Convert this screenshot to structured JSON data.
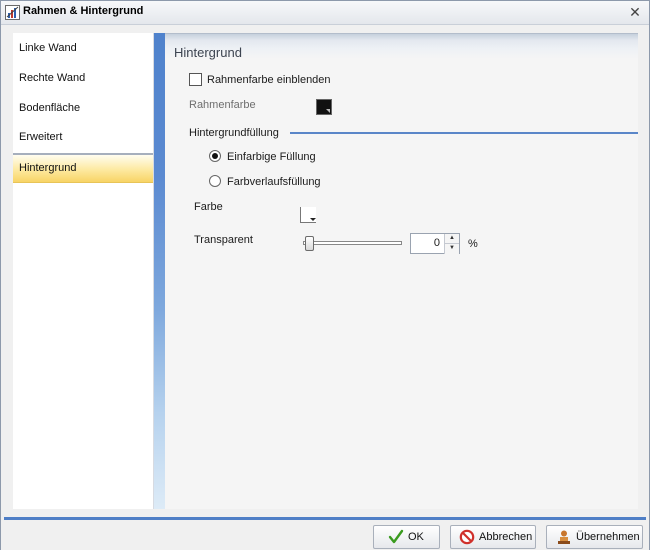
{
  "window": {
    "title": "Rahmen & Hintergrund",
    "app_icon": "chart-properties-icon",
    "close_icon": "close-icon"
  },
  "nav": {
    "items": [
      {
        "label": "Linke Wand"
      },
      {
        "label": "Rechte Wand"
      },
      {
        "label": "Bodenfläche"
      },
      {
        "label": "Erweitert"
      },
      {
        "label": "Hintergrund",
        "active": true
      }
    ]
  },
  "section": {
    "title": "Hintergrund"
  },
  "border": {
    "show_label": "Rahmenfarbe einblenden",
    "show_checked": false,
    "color_label": "Rahmenfarbe",
    "color_value": "#111111"
  },
  "fill": {
    "group_label": "Hintergrundfüllung",
    "solid_label": "Einfarbige Füllung",
    "solid_selected": true,
    "gradient_label": "Farbverlaufsfüllung",
    "gradient_selected": false,
    "color_label": "Farbe",
    "color_value": "#ffffff",
    "transparent_label": "Transparent",
    "transparent_value": "0",
    "transparent_unit": "%",
    "transparent_fraction": 0
  },
  "footer": {
    "ok_label": "OK",
    "cancel_label": "Abbrechen",
    "apply_label": "Übernehmen"
  },
  "colors": {
    "accent": "#4f7fc6",
    "active_item": "#fde9a0"
  }
}
